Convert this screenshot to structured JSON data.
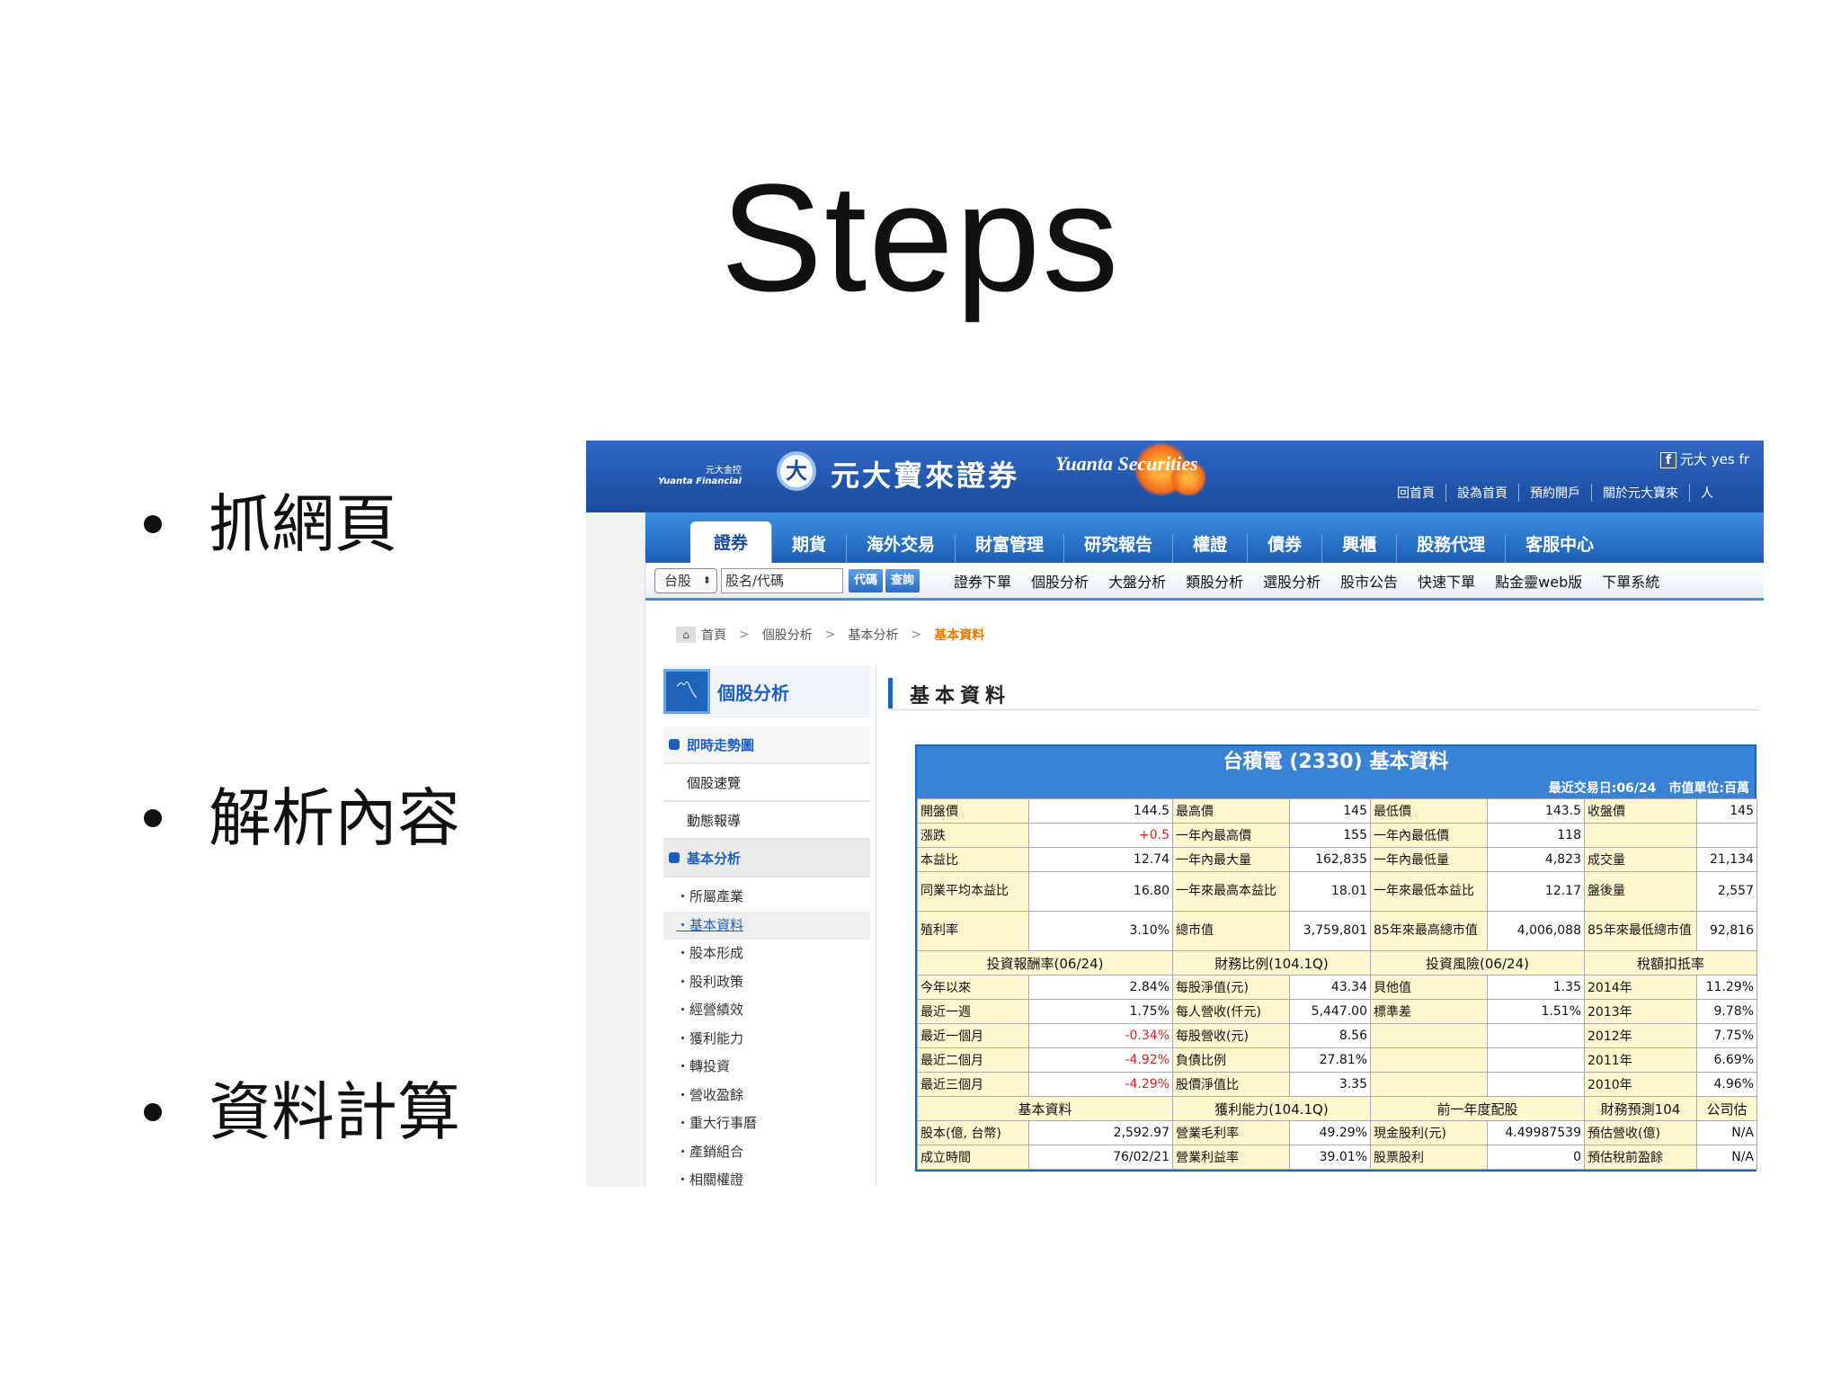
{
  "slide": {
    "title": "Steps",
    "bullets": [
      "抓網頁",
      "解析內容",
      "資料計算"
    ]
  },
  "screenshot": {
    "brand": {
      "group_zh": "元大金控",
      "group_en": "Yuanta Financial",
      "logo_glyph": "大",
      "name": "元大寶來證券",
      "en": "Yuanta Securities"
    },
    "fb_text": "元大 yes fr",
    "top_links": [
      "回首頁",
      "設為首頁",
      "預約開戶",
      "關於元大寶來",
      "人"
    ],
    "nav": [
      "證券",
      "期貨",
      "海外交易",
      "財富管理",
      "研究報告",
      "權證",
      "債券",
      "興櫃",
      "股務代理",
      "客服中心"
    ],
    "search": {
      "market": "台股",
      "placeholder": "股名/代碼",
      "code_btn": "代碼",
      "query_btn": "查詢"
    },
    "sub_links": [
      "證券下單",
      "個股分析",
      "大盤分析",
      "類股分析",
      "選股分析",
      "股市公告",
      "快速下單",
      "點金靈web版",
      "下單系統"
    ],
    "breadcrumb": [
      "首頁",
      "個股分析",
      "基本分析",
      "基本資料"
    ],
    "breadcrumb_sep": ">",
    "sidebar": {
      "title": "個股分析",
      "items": [
        "即時走勢圖",
        "個股速覽",
        "動態報導",
        "基本分析"
      ],
      "sub_items": [
        "所屬產業",
        "基本資料",
        "股本形成",
        "股利政策",
        "經營績效",
        "獲利能力",
        "轉投資",
        "營收盈餘",
        "重大行事曆",
        "產銷組合",
        "相關權證"
      ]
    },
    "section_title": "基本資料",
    "table": {
      "title": "台積電 (2330) 基本資料",
      "subtitle": "最近交易日:06/24　市值單位:百萬",
      "rows1": [
        [
          "開盤價",
          "144.5",
          "最高價",
          "145",
          "最低價",
          "143.5",
          "收盤價",
          "145"
        ],
        [
          "漲跌",
          "+0.5",
          "一年內最高價",
          "155",
          "一年內最低價",
          "118",
          "",
          ""
        ],
        [
          "本益比",
          "12.74",
          "一年內最大量",
          "162,835",
          "一年內最低量",
          "4,823",
          "成交量",
          "21,134"
        ],
        [
          "同業平均本益比",
          "16.80",
          "一年來最高本益比",
          "18.01",
          "一年來最低本益比",
          "12.17",
          "盤後量",
          "2,557"
        ],
        [
          "殖利率",
          "3.10%",
          "總市值",
          "3,759,801",
          "85年來最高總市值",
          "4,006,088",
          "85年來最低總市值",
          "92,816"
        ]
      ],
      "headers1": [
        "投資報酬率(06/24)",
        "財務比例(104.1Q)",
        "投資風險(06/24)",
        "稅額扣抵率"
      ],
      "rows2": [
        [
          "今年以來",
          "2.84%",
          "每股淨值(元)",
          "43.34",
          "貝他值",
          "1.35",
          "2014年",
          "11.29%"
        ],
        [
          "最近一週",
          "1.75%",
          "每人營收(仟元)",
          "5,447.00",
          "標準差",
          "1.51%",
          "2013年",
          "9.78%"
        ],
        [
          "最近一個月",
          "-0.34%",
          "每股營收(元)",
          "8.56",
          "",
          "",
          "2012年",
          "7.75%"
        ],
        [
          "最近二個月",
          "-4.92%",
          "負債比例",
          "27.81%",
          "",
          "",
          "2011年",
          "6.69%"
        ],
        [
          "最近三個月",
          "-4.29%",
          "股價淨值比",
          "3.35",
          "",
          "",
          "2010年",
          "4.96%"
        ]
      ],
      "headers2": [
        "基本資料",
        "獲利能力(104.1Q)",
        "前一年度配股",
        "財務預測104",
        "公司估"
      ],
      "rows3": [
        [
          "股本(億, 台幣)",
          "2,592.97",
          "營業毛利率",
          "49.29%",
          "現金股利(元)",
          "4.49987539",
          "預估營收(億)",
          "N/A"
        ],
        [
          "成立時間",
          "76/02/21",
          "營業利益率",
          "39.01%",
          "股票股利",
          "0",
          "預估稅前盈餘",
          "N/A"
        ]
      ]
    }
  }
}
